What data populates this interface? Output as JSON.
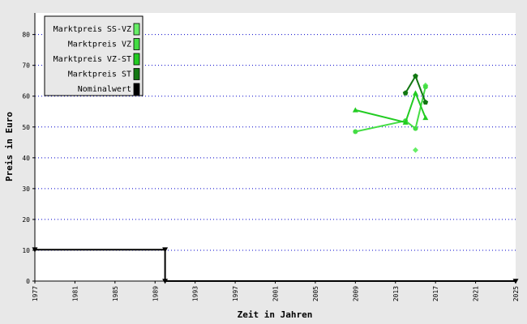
{
  "chart_data": {
    "type": "line",
    "xlabel": "Zeit in Jahren",
    "ylabel": "Preis in Euro",
    "xlim": [
      1977,
      2025
    ],
    "ylim": [
      0,
      87
    ],
    "x_ticks": [
      1977,
      1981,
      1985,
      1989,
      1993,
      1997,
      2001,
      2005,
      2009,
      2013,
      2017,
      2021,
      2025
    ],
    "y_ticks": [
      0,
      10,
      20,
      30,
      40,
      50,
      60,
      70,
      80
    ],
    "grid": "horizontal-dotted",
    "legend_position": "top-left",
    "background": "#ffffff",
    "outer_background": "#e8e8e8",
    "grid_color": "#0000cc",
    "series": [
      {
        "name": "Marktpreis SS-VZ",
        "color": "#66ee66",
        "marker": "diamond",
        "points": [
          [
            2015.0,
            42.5
          ],
          [
            2016.0,
            63.5
          ]
        ]
      },
      {
        "name": "Marktpreis VZ",
        "color": "#44dd44",
        "marker": "circle",
        "points": [
          [
            2009.0,
            48.5
          ],
          [
            2014.0,
            52.0
          ],
          [
            2015.0,
            49.5
          ],
          [
            2016.0,
            63.0
          ]
        ]
      },
      {
        "name": "Marktpreis VZ-ST",
        "color": "#22cc22",
        "marker": "triangle",
        "points": [
          [
            2009.0,
            55.5
          ],
          [
            2014.0,
            51.5
          ],
          [
            2015.0,
            61.0
          ],
          [
            2016.0,
            53.0
          ]
        ]
      },
      {
        "name": "Marktpreis ST",
        "color": "#117711",
        "marker": "pentagon",
        "points": [
          [
            2014.0,
            61.0
          ],
          [
            2015.0,
            66.5
          ],
          [
            2016.0,
            58.0
          ]
        ]
      },
      {
        "name": "Nominalwert",
        "color": "#000000",
        "marker": "triangle-down",
        "step": true,
        "points": [
          [
            1977.0,
            10.2
          ],
          [
            1990.0,
            10.2
          ],
          [
            1990.0,
            0
          ],
          [
            2025.0,
            0
          ]
        ]
      }
    ]
  }
}
